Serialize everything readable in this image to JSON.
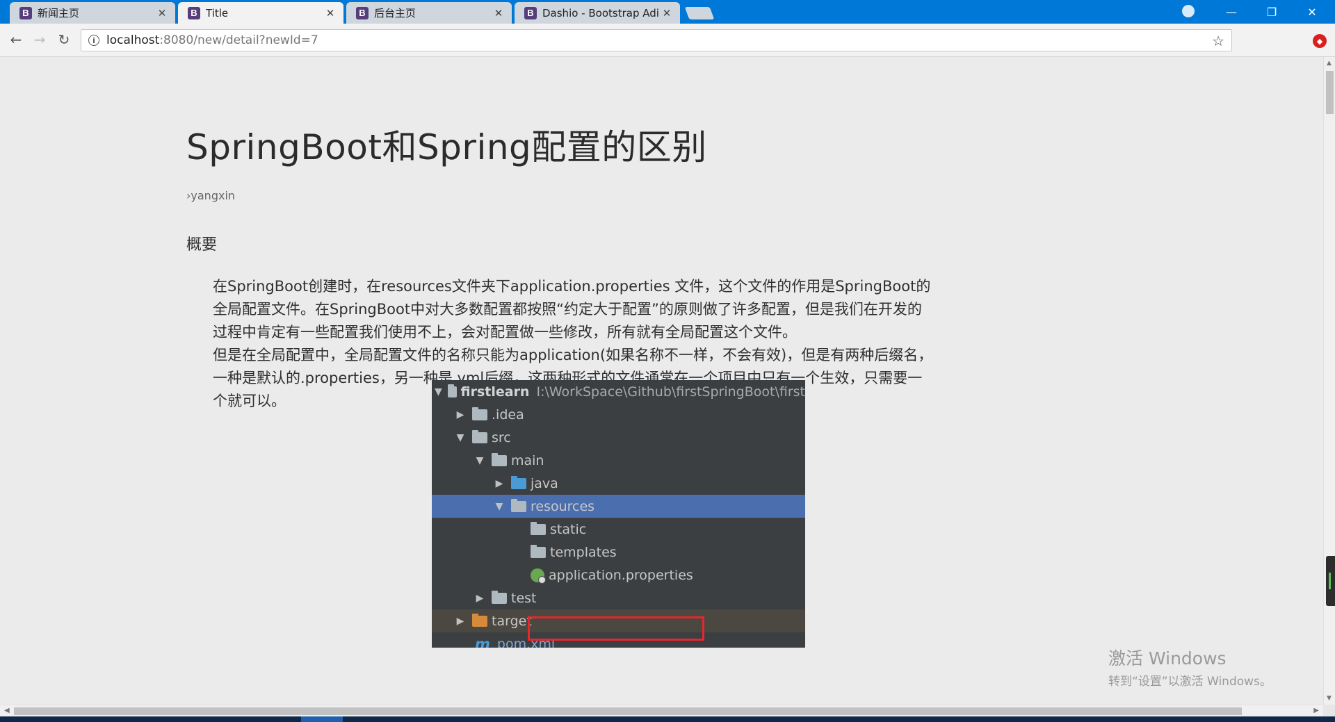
{
  "tabs": [
    {
      "label": "新闻主页",
      "active": false
    },
    {
      "label": "Title",
      "active": true
    },
    {
      "label": "后台主页",
      "active": false
    },
    {
      "label": "Dashio - Bootstrap Adi",
      "active": false
    }
  ],
  "favicon_letter": "B",
  "window": {
    "minimize": "—",
    "restore": "❐",
    "close": "✕"
  },
  "address": {
    "host": "localhost",
    "path": ":8080/new/detail?newId=7"
  },
  "article": {
    "title": "SpringBoot和Spring配置的区别",
    "author": "›yangxin",
    "section": "概要",
    "paragraphs": [
      "在SpringBoot创建时，在resources文件夹下application.properties 文件，这个文件的作用是SpringBoot的全局配置文件。在SpringBoot中对大多数配置都按照“约定大于配置”的原则做了许多配置，但是我们在开发的过程中肯定有一些配置我们使用不上，会对配置做一些修改，所有就有全局配置这个文件。",
      "但是在全局配置中，全局配置文件的名称只能为application(如果名称不一样，不会有效)，但是有两种后缀名，一种是默认的.properties，另一种是.yml后缀，这两种形式的文件通常在一个项目中只有一个生效，只需要一个就可以。"
    ]
  },
  "ide_tree": {
    "root_name": "firstlearn",
    "root_path": "I:\\WorkSpace\\Github\\firstSpringBoot\\first",
    "idea": ".idea",
    "src": "src",
    "main": "main",
    "java": "java",
    "resources": "resources",
    "static": "static",
    "templates": "templates",
    "app_props": "application.properties",
    "test": "test",
    "target": "target",
    "pom": "pom.xml",
    "m_icon": "m"
  },
  "watermark": {
    "line1": "激活 Windows",
    "line2": "转到“设置”以激活 Windows。"
  }
}
